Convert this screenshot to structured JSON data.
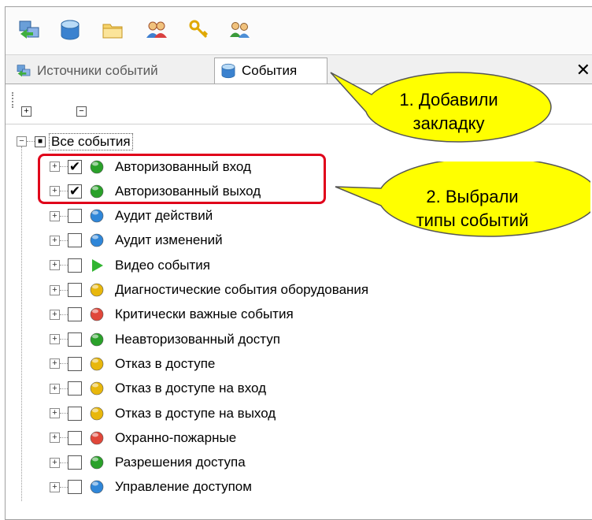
{
  "toolbar": {
    "buttons": [
      {
        "icon": "event-sources-icon"
      },
      {
        "icon": "events-database-icon"
      },
      {
        "icon": "folder-icon"
      },
      {
        "icon": "users-icon"
      },
      {
        "icon": "keys-icon"
      },
      {
        "icon": "user-groups-icon"
      }
    ]
  },
  "tabs": {
    "sources_label": "Источники событий",
    "events_label": "События",
    "close_glyph": "✕"
  },
  "subtoolbar": {
    "expand_all": "+",
    "collapse_all": "−"
  },
  "tree": {
    "root": {
      "label": "Все события",
      "expander": "−",
      "state": "indeterminate",
      "state_glyph": "■"
    },
    "items": [
      {
        "label": "Авторизованный вход",
        "checked": true,
        "icon": "green-circle-icon",
        "color": "#2aa12a"
      },
      {
        "label": "Авторизованный выход",
        "checked": true,
        "icon": "green-circle-icon",
        "color": "#2aa12a"
      },
      {
        "label": "Аудит действий",
        "checked": false,
        "icon": "blue-circle-icon",
        "color": "#2f86d8"
      },
      {
        "label": "Аудит изменений",
        "checked": false,
        "icon": "blue-circle-icon",
        "color": "#2f86d8"
      },
      {
        "label": "Видео события",
        "checked": false,
        "icon": "play-triangle-icon",
        "color": "#31b531"
      },
      {
        "label": "Диагностические события оборудования",
        "checked": false,
        "icon": "yellow-circle-icon",
        "color": "#e8b70c"
      },
      {
        "label": "Критически важные события",
        "checked": false,
        "icon": "red-circle-icon",
        "color": "#e0473a"
      },
      {
        "label": "Неавторизованный доступ",
        "checked": false,
        "icon": "green-circle-icon",
        "color": "#2aa12a"
      },
      {
        "label": "Отказ в доступе",
        "checked": false,
        "icon": "yellow-circle-icon",
        "color": "#e8b70c"
      },
      {
        "label": "Отказ в доступе на вход",
        "checked": false,
        "icon": "yellow-circle-icon",
        "color": "#e8b70c"
      },
      {
        "label": "Отказ в доступе на выход",
        "checked": false,
        "icon": "yellow-circle-icon",
        "color": "#e8b70c"
      },
      {
        "label": "Охранно-пожарные",
        "checked": false,
        "icon": "red-circle-icon",
        "color": "#e0473a"
      },
      {
        "label": "Разрешения доступа",
        "checked": false,
        "icon": "green-circle-icon",
        "color": "#2aa12a"
      },
      {
        "label": "Управление доступом",
        "checked": false,
        "icon": "blue-circle-icon",
        "color": "#2f86d8"
      }
    ],
    "item_expander": "+",
    "check_glyph": "✔"
  },
  "callouts": [
    {
      "line1": "1. Добавили",
      "line2": "закладку"
    },
    {
      "line1": "2. Выбрали",
      "line2": "типы событий"
    }
  ],
  "colors": {
    "highlight": "#e0001a",
    "callout_fill": "#ffff00"
  }
}
